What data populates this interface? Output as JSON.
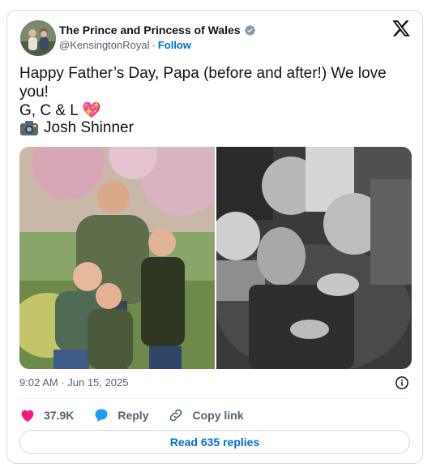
{
  "author": {
    "display_name": "The Prince and Princess of Wales",
    "handle": "@KensingtonRoyal",
    "separator": "·",
    "follow_label": "Follow",
    "verified": true
  },
  "tweet": {
    "text": "Happy Father’s Day, Papa (before and after!) We love you!\nG, C & L 💖",
    "photo_credit": "Josh Shinner",
    "timestamp": "9:02 AM · Jun 15, 2025"
  },
  "media": [
    {
      "kind": "color-photo",
      "icon": "family-photo"
    },
    {
      "kind": "black-and-white-photo",
      "icon": "family-photo"
    }
  ],
  "actions": {
    "likes": "37.9K",
    "reply_label": "Reply",
    "copy_link_label": "Copy link"
  },
  "read_replies_label": "Read 635 replies",
  "colors": {
    "accent": "#006fd6",
    "like": "#f91880",
    "reply_icon": "#1d9bf0",
    "verified": "#829aab",
    "muted": "#536471",
    "border": "#cfd9de"
  }
}
